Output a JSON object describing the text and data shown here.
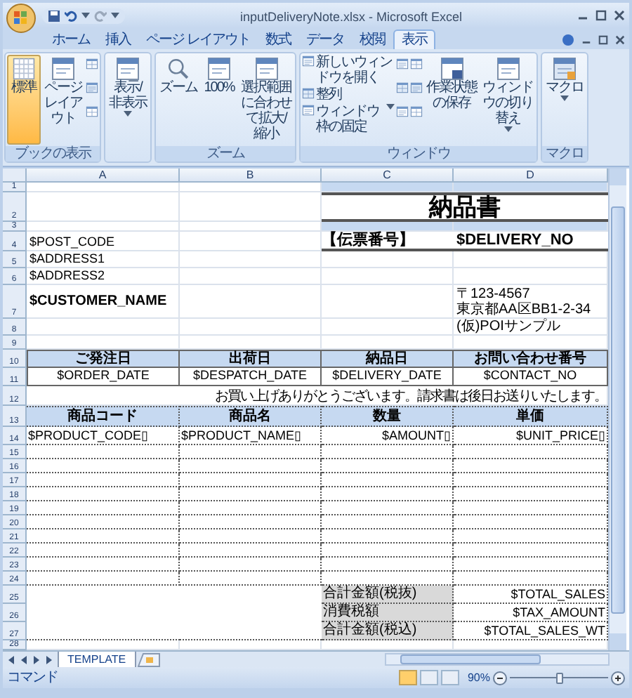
{
  "window": {
    "title": "inputDeliveryNote.xlsx - Microsoft Excel"
  },
  "ribbon": {
    "tabs": [
      {
        "label": "ホーム",
        "selected": false
      },
      {
        "label": "挿入",
        "selected": false
      },
      {
        "label": "ページ レイアウト",
        "selected": false
      },
      {
        "label": "数式",
        "selected": false
      },
      {
        "label": "データ",
        "selected": false
      },
      {
        "label": "校閲",
        "selected": false
      },
      {
        "label": "表示",
        "selected": true
      }
    ],
    "groups": [
      {
        "label": "ブックの表示",
        "items": [
          {
            "kind": "large",
            "label": "標準",
            "selected": true,
            "dropdown": false
          },
          {
            "kind": "large",
            "label": "ページレイアウト",
            "selected": false,
            "dropdown": false
          },
          {
            "kind": "icons"
          }
        ]
      },
      {
        "items": [
          {
            "kind": "large",
            "label": "表示/非表示",
            "selected": false,
            "dropdown": true
          }
        ]
      },
      {
        "label": "ズーム",
        "items": [
          {
            "kind": "large",
            "label": "ズーム",
            "selected": false,
            "dropdown": false
          },
          {
            "kind": "large",
            "label": "100%",
            "selected": false,
            "dropdown": false
          },
          {
            "kind": "large",
            "label": "選択範囲に合わせて拡大/縮小",
            "selected": false,
            "dropdown": false
          }
        ]
      },
      {
        "label": "ウィンドウ",
        "items": [
          {
            "kind": "small_list",
            "entries": [
              {
                "label": "新しいウィンドウを開く",
                "dropdown": false
              },
              {
                "label": "整列",
                "dropdown": false
              },
              {
                "label": "ウィンドウ枠の固定",
                "dropdown": true
              }
            ]
          },
          {
            "kind": "icons"
          },
          {
            "kind": "icons"
          },
          {
            "kind": "large",
            "label": "作業状態の保存",
            "selected": false,
            "dropdown": false
          },
          {
            "kind": "large",
            "label": "ウィンドウの切り替え",
            "selected": false,
            "dropdown": true
          }
        ]
      },
      {
        "label": "マクロ",
        "items": [
          {
            "kind": "large",
            "label": "マクロ",
            "selected": false,
            "dropdown": true
          }
        ]
      }
    ]
  },
  "sheet": {
    "columns": [
      "A",
      "B",
      "C",
      "D"
    ],
    "row_numbers": [
      "1",
      "2",
      "3",
      "4",
      "5",
      "6",
      "7",
      "8",
      "9",
      "10",
      "11",
      "12",
      "13",
      "14",
      "15",
      "16",
      "17",
      "18",
      "19",
      "20",
      "21",
      "22",
      "23",
      "24",
      "25",
      "26",
      "27",
      "28"
    ],
    "title": "納品書",
    "slip_label": "【伝票番号】",
    "slip_value": "$DELIVERY_NO",
    "address_lines": [
      "$POST_CODE",
      "$ADDRESS1",
      "$ADDRESS2"
    ],
    "customer": "$CUSTOMER_NAME",
    "sender_lines": [
      "〒123-4567",
      "東京都AA区BB1-2-34",
      "(仮)POIサンプル"
    ],
    "date_headers": [
      "ご発注日",
      "出荷日",
      "納品日",
      "お問い合わせ番号"
    ],
    "date_values": [
      "$ORDER_DATE",
      "$DESPATCH_DATE",
      "$DELIVERY_DATE",
      "$CONTACT_NO"
    ],
    "message": "お買い上げありがとうございます。請求書は後日お送りいたします。",
    "item_headers": [
      "商品コード",
      "商品名",
      "数量",
      "単価"
    ],
    "item_values": [
      "$PRODUCT_CODE▯",
      "$PRODUCT_NAME▯",
      "$AMOUNT▯",
      "$UNIT_PRICE▯"
    ],
    "totals": [
      {
        "label": "合計金額(税抜)",
        "value": "$TOTAL_SALES"
      },
      {
        "label": "消費税額",
        "value": "$TAX_AMOUNT"
      },
      {
        "label": "合計金額(税込)",
        "value": "$TOTAL_SALES_WT"
      }
    ]
  },
  "sheet_tabs": [
    {
      "label": "TEMPLATE",
      "selected": true
    }
  ],
  "status_bar": {
    "mode": "コマンド",
    "views": [
      {
        "selected": true
      },
      {
        "selected": false
      },
      {
        "selected": false
      }
    ],
    "zoom": "90%",
    "zoom_slider": {
      "level": 0.5
    }
  }
}
